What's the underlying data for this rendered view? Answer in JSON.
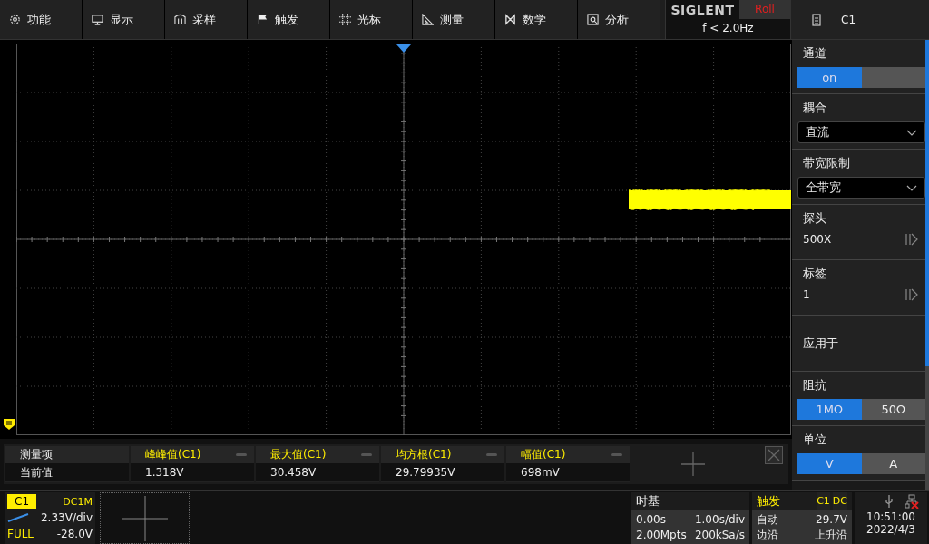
{
  "menu": [
    {
      "label": "功能",
      "kind": "gear"
    },
    {
      "label": "显示",
      "kind": "monitor"
    },
    {
      "label": "采样",
      "kind": "sample"
    },
    {
      "label": "触发",
      "kind": "flag"
    },
    {
      "label": "光标",
      "kind": "cursor"
    },
    {
      "label": "测量",
      "kind": "measure"
    },
    {
      "label": "数学",
      "kind": "math"
    },
    {
      "label": "分析",
      "kind": "analysis"
    }
  ],
  "brand": {
    "logo": "SIGLENT",
    "mode": "Roll",
    "frequency": "f < 2.0Hz"
  },
  "side_panel": {
    "title": "C1",
    "items": [
      {
        "kind": "toggle",
        "label": "通道",
        "options": [
          {
            "label": "on",
            "selected": true
          },
          {
            "selected": false
          }
        ]
      },
      {
        "kind": "dropdown",
        "label": "耦合",
        "value": "直流"
      },
      {
        "kind": "dropdown",
        "label": "带宽限制",
        "value": "全带宽"
      },
      {
        "kind": "submenu",
        "label": "探头",
        "value": "500X"
      },
      {
        "kind": "submenu",
        "label": "标签",
        "value": "1"
      },
      {
        "kind": "action",
        "label": "应用于"
      },
      {
        "kind": "toggle",
        "label": "阻抗",
        "options": [
          {
            "label": "1MΩ",
            "selected": true
          },
          {
            "label": "50Ω",
            "selected": false
          }
        ]
      },
      {
        "kind": "toggle",
        "label": "单位",
        "options": [
          {
            "label": "V",
            "selected": true
          },
          {
            "label": "A",
            "selected": false
          }
        ]
      }
    ]
  },
  "measurements": {
    "header_label": "测量项",
    "value_label": "当前值",
    "items": [
      {
        "name": "峰峰值(C1)",
        "value": "1.318V"
      },
      {
        "name": "最大值(C1)",
        "value": "30.458V"
      },
      {
        "name": "均方根(C1)",
        "value": "29.79935V"
      },
      {
        "name": "幅值(C1)",
        "value": "698mV"
      }
    ]
  },
  "channel": {
    "name": "C1",
    "coupling": "DC1M",
    "scale": "2.33V/div",
    "bandwidth": "FULL",
    "offset": "-28.0V"
  },
  "timebase": {
    "title": "时基",
    "delay": "0.00s",
    "scale": "1.00s/div",
    "memory": "2.00Mpts",
    "sample_rate": "200kSa/s"
  },
  "trigger": {
    "title": "触发",
    "source": "C1",
    "coupling": "DC",
    "mode": "自动",
    "level": "29.7V",
    "type": "边沿",
    "slope": "上升沿"
  },
  "status": {
    "time": "10:51:00",
    "date": "2022/4/3"
  }
}
